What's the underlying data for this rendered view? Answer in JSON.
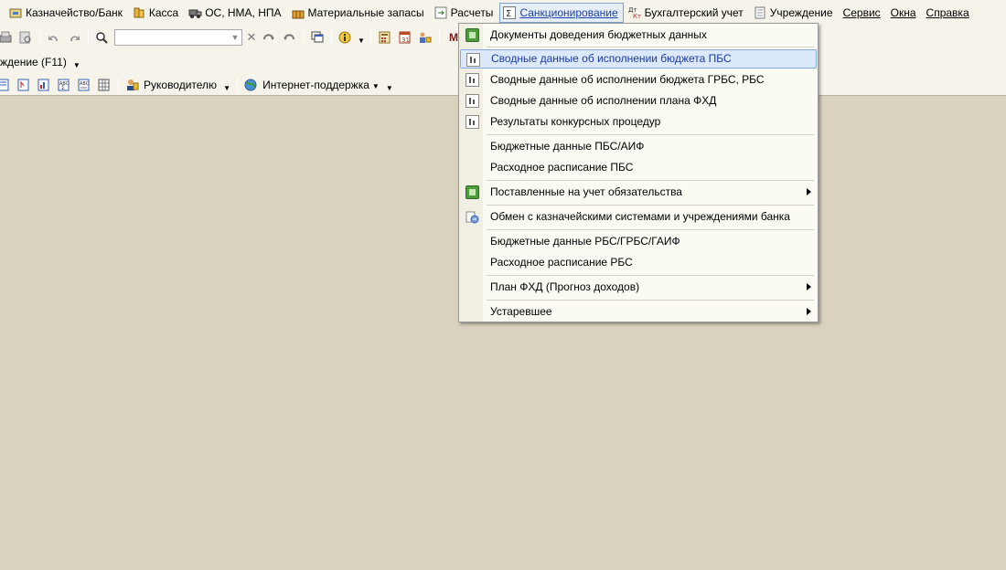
{
  "menubar": {
    "items": [
      {
        "label": "Казначейство/Банк",
        "icon": "treasury-bank-icon"
      },
      {
        "label": "Касса",
        "icon": "cash-icon"
      },
      {
        "label": "ОС, НМА, НПА",
        "icon": "fixed-assets-icon"
      },
      {
        "label": "Материальные запасы",
        "icon": "inventory-icon"
      },
      {
        "label": "Расчеты",
        "icon": "settlements-icon"
      },
      {
        "label": "Санкционирование",
        "icon": "sum-icon"
      },
      {
        "label": "Бухгалтерский учет",
        "icon": "debit-credit-icon"
      },
      {
        "label": "Учреждение",
        "icon": "institution-icon"
      },
      {
        "label": "Сервис"
      },
      {
        "label": "Окна"
      },
      {
        "label": "Справка"
      }
    ]
  },
  "toolbar2": {
    "label": "ждение (F11)"
  },
  "toolbar3": {
    "managers_label": "Руководителю",
    "support_label": "Интернет-поддержка"
  },
  "search": {
    "value": ""
  },
  "dropdown": {
    "items": [
      {
        "label": "Документы доведения бюджетных данных",
        "icon": "green-doc-icon"
      },
      {
        "label": "Сводные данные об исполнении бюджета ПБС",
        "icon": "report-icon"
      },
      {
        "label": "Сводные данные об исполнении бюджета ГРБС, РБС",
        "icon": "report-icon"
      },
      {
        "label": "Сводные данные об исполнении плана ФХД",
        "icon": "report-icon"
      },
      {
        "label": "Результаты конкурсных процедур",
        "icon": "report-icon"
      },
      {
        "label": "Бюджетные данные ПБС/АИФ"
      },
      {
        "label": "Расходное расписание ПБС"
      },
      {
        "label": "Поставленные на учет обязательства",
        "icon": "green-doc-icon"
      },
      {
        "label": "Обмен с казначейскими системами и учреждениями банка",
        "icon": "exchange-icon"
      },
      {
        "label": "Бюджетные данные РБС/ГРБС/ГАИФ"
      },
      {
        "label": "Расходное расписание РБС"
      },
      {
        "label": "План ФХД (Прогноз доходов)"
      },
      {
        "label": "Устаревшее"
      }
    ]
  }
}
